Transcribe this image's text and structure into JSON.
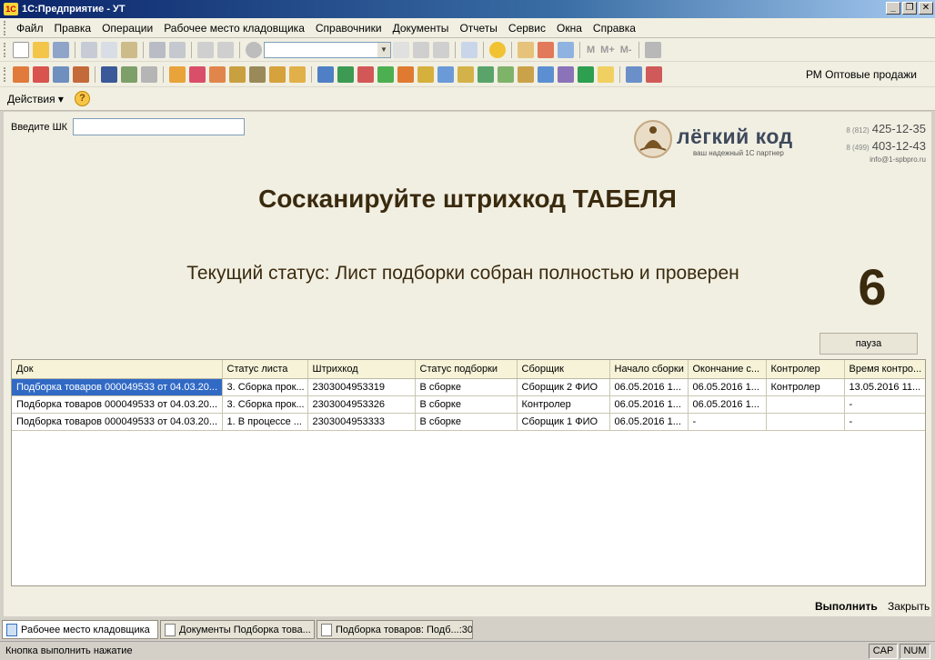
{
  "window": {
    "title": "1С:Предприятие - УТ",
    "logo_text": "1С"
  },
  "menu": [
    "Файл",
    "Правка",
    "Операции",
    "Рабочее место кладовщика",
    "Справочники",
    "Документы",
    "Отчеты",
    "Сервис",
    "Окна",
    "Справка"
  ],
  "toolbar": {
    "m_label": "M",
    "mplus_label": "M+",
    "mminus_label": "M-",
    "rm_label": "РМ Оптовые продажи"
  },
  "actions": {
    "label": "Действия ▾",
    "help": "?"
  },
  "form": {
    "sk_label": "Введите ШК",
    "sk_value": "",
    "logo": {
      "name": "лёгкий код",
      "tagline": "ваш надежный 1С партнер"
    },
    "contacts": {
      "phone1_code": "8 (812)",
      "phone1": "425-12-35",
      "phone2_code": "8 (499)",
      "phone2": "403-12-43",
      "email": "info@1-spbpro.ru"
    },
    "headline": "Сосканируйте штрихкод ТАБЕЛЯ",
    "status": "Текущий статус: Лист подборки собран полностью и проверен",
    "counter": "6",
    "pause_label": "пауза",
    "execute_label": "Выполнить",
    "close_label": "Закрыть"
  },
  "table": {
    "columns": [
      "Док",
      "Статус листа",
      "Штрихкод",
      "Статус подборки",
      "Сборщик",
      "Начало сборки",
      "Окончание с...",
      "Контролер",
      "Время контро..."
    ],
    "rows": [
      [
        "Подборка товаров 000049533 от 04.03.20...",
        "3. Сборка прок...",
        "2303004953319",
        "В сборке",
        "Сборщик 2 ФИО",
        "06.05.2016 1...",
        "06.05.2016 1...",
        "Контролер",
        "13.05.2016 11..."
      ],
      [
        "Подборка товаров 000049533 от 04.03.20...",
        "3. Сборка прок...",
        "2303004953326",
        "В сборке",
        "Контролер",
        "06.05.2016 1...",
        "06.05.2016 1...",
        "",
        "-"
      ],
      [
        "Подборка товаров 000049533 от 04.03.20...",
        "1. В процессе ...",
        "2303004953333",
        "В сборке",
        "Сборщик 1 ФИО",
        "06.05.2016 1...",
        "-",
        "",
        "-"
      ]
    ]
  },
  "taskbar": [
    "Рабочее место кладовщика",
    "Документы Подборка това...",
    "Подборка товаров: Подб...:30"
  ],
  "statusbar": {
    "message": "Кнопка выполнить нажатие",
    "cap": "CAP",
    "num": "NUM"
  }
}
